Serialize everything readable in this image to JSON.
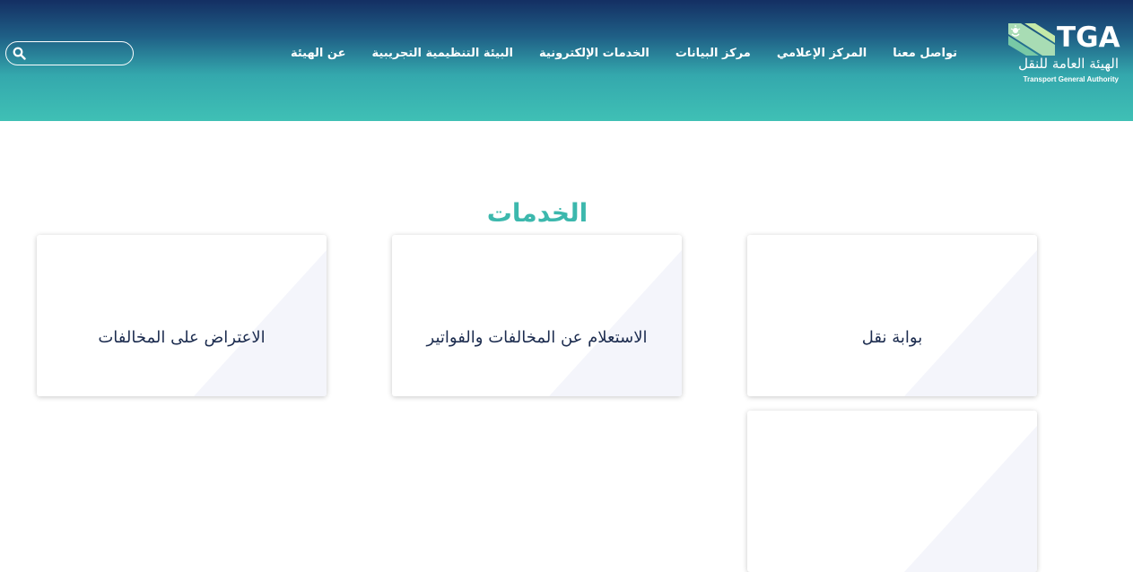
{
  "header": {
    "logo": {
      "abbr": "TGA",
      "name_ar": "الهيئة العامة للنقل",
      "name_en": "Transport General Authority"
    },
    "nav": [
      {
        "label": "عن الهيئة"
      },
      {
        "label": "البيئة التنظيمية التجريبية"
      },
      {
        "label": "الخدمات الإلكترونية"
      },
      {
        "label": "مركز البيانات"
      },
      {
        "label": "المركز الإعلامي"
      },
      {
        "label": "تواصل معنا"
      }
    ],
    "search": {
      "value": "",
      "placeholder": "",
      "icon": "search-icon"
    }
  },
  "main": {
    "title": "الخدمات",
    "cards": [
      {
        "label": "بوابة نقل"
      },
      {
        "label": "الاستعلام عن المخالفات والفواتير"
      },
      {
        "label": "الاعتراض على المخالفات"
      },
      {
        "label": ""
      }
    ]
  },
  "colors": {
    "header_top": "#142f63",
    "header_bottom": "#3fc0b5",
    "accent": "#3cb8ad",
    "card_text": "#1c2c4f",
    "logo_green": "#9fd7b2"
  }
}
